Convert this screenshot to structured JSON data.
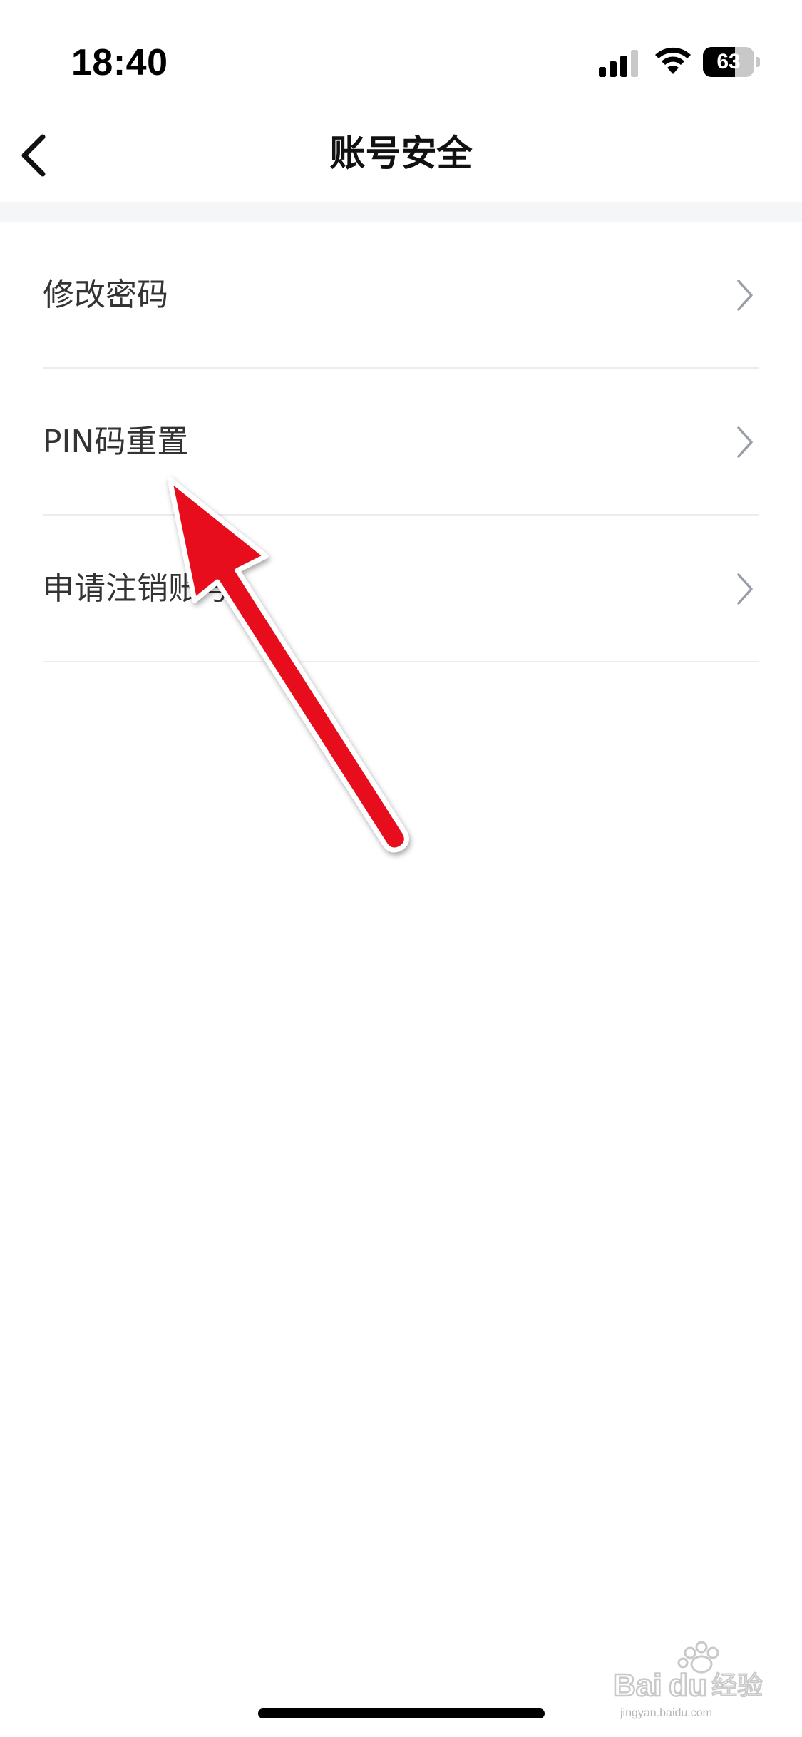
{
  "status_bar": {
    "time": "18:40",
    "battery_level": "63",
    "battery_fraction": 0.63,
    "icons": [
      "signal-icon",
      "wifi-icon",
      "battery-icon"
    ]
  },
  "nav": {
    "title": "账号安全",
    "back_icon": "chevron-left-icon"
  },
  "menu": {
    "items": [
      {
        "label": "修改密码",
        "icon": "chevron-right-icon"
      },
      {
        "label": "PIN码重置",
        "icon": "chevron-right-icon"
      },
      {
        "label": "申请注销账号",
        "icon": "chevron-right-icon"
      }
    ]
  },
  "annotation": {
    "color": "#e8101e",
    "points_to": "PIN码重置"
  },
  "watermark": {
    "brand": "Baidu经验",
    "url": "jingyan.baidu.com"
  },
  "colors": {
    "background": "#ffffff",
    "section_gap": "#f5f6f8",
    "text_primary": "#111111",
    "text_item": "#333333",
    "chevron": "#9a9ea8",
    "divider": "#ececec"
  }
}
